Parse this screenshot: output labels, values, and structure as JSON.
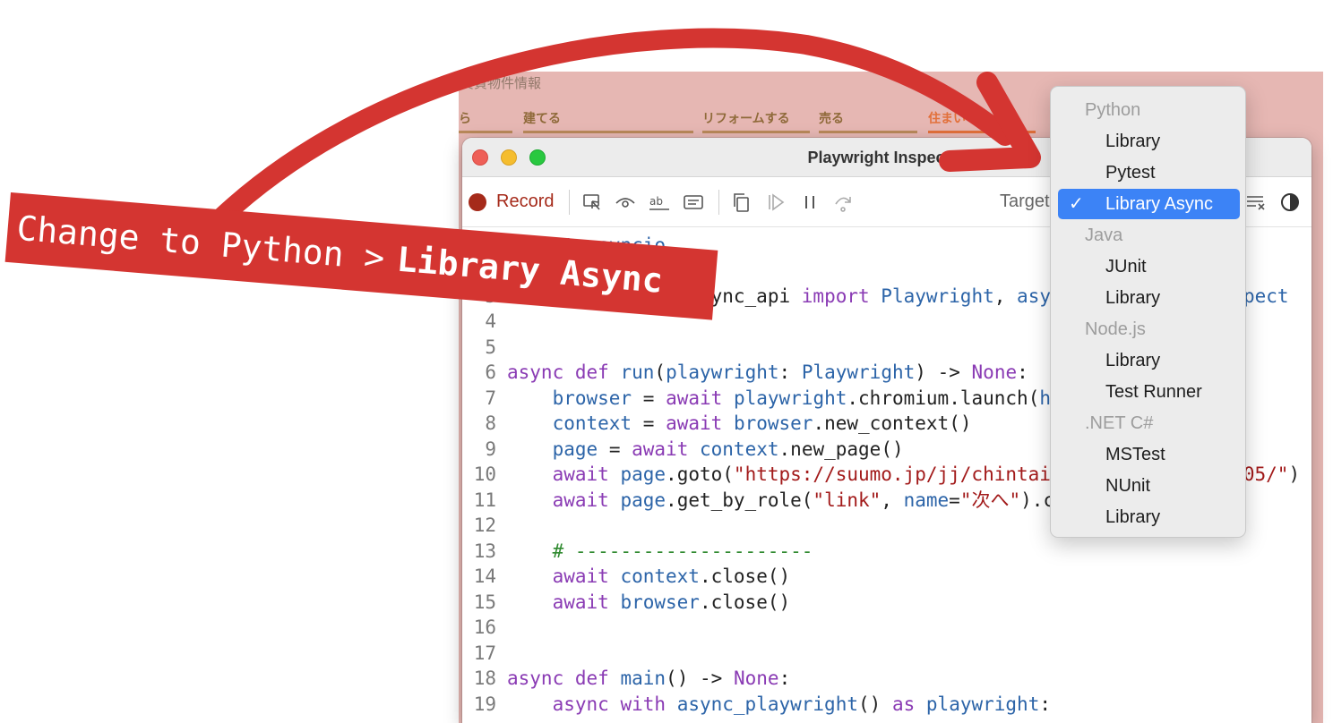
{
  "background_site": {
    "title_fragment": "賃貸物件情報",
    "nav": [
      "ら",
      "建てる",
      "リフォームする",
      "売る",
      "住まい"
    ]
  },
  "window": {
    "title": "Playwright Inspector",
    "record_label": "Record",
    "target_label": "Target:"
  },
  "toolbar_icons": [
    "pick-locator-icon",
    "assert-visibility-icon",
    "assert-text-icon",
    "assert-value-icon",
    "copy-icon",
    "resume-icon",
    "pause-icon",
    "step-over-icon",
    "clear-icon",
    "theme-toggle-icon"
  ],
  "code_lines": [
    {
      "n": "1",
      "text": "import asyncio"
    },
    {
      "n": "3",
      "text": "from playwright.async_api import Playwright, async_playwright, expect"
    },
    {
      "n": "4",
      "text": ""
    },
    {
      "n": "5",
      "text": ""
    },
    {
      "n": "6",
      "text": "async def run(playwright: Playwright) -> None:"
    },
    {
      "n": "7",
      "text": "    browser = await playwright.chromium.launch(headless=False)"
    },
    {
      "n": "8",
      "text": "    context = await browser.new_context()"
    },
    {
      "n": "9",
      "text": "    page = await context.new_page()"
    },
    {
      "n": "10",
      "text": "    await page.goto(\"https://suumo.jp/jj/chintai/ichiran/FR301FC005/\")"
    },
    {
      "n": "11",
      "text": "    await page.get_by_role(\"link\", name=\"次へ\").click()"
    },
    {
      "n": "12",
      "text": ""
    },
    {
      "n": "13",
      "text": "    # ---------------------"
    },
    {
      "n": "14",
      "text": "    await context.close()"
    },
    {
      "n": "15",
      "text": "    await browser.close()"
    },
    {
      "n": "16",
      "text": ""
    },
    {
      "n": "17",
      "text": ""
    },
    {
      "n": "18",
      "text": "async def main() -> None:"
    },
    {
      "n": "19",
      "text": "    async with async_playwright() as playwright:"
    }
  ],
  "menu": {
    "groups": [
      {
        "label": "Python",
        "items": [
          "Library",
          "Pytest",
          "Library Async"
        ]
      },
      {
        "label": "Java",
        "items": [
          "JUnit",
          "Library"
        ]
      },
      {
        "label": "Node.js",
        "items": [
          "Library",
          "Test Runner"
        ]
      },
      {
        "label": ".NET C#",
        "items": [
          "MSTest",
          "NUnit",
          "Library"
        ]
      }
    ],
    "selected": "Library Async",
    "check_glyph": "✓"
  },
  "annotation": {
    "prefix": "Change to Python >",
    "emphasis": "Library Async",
    "color": "#d43531"
  },
  "colors": {
    "record": "#a52a1a",
    "selection": "#3c83f6",
    "keyword": "#8a3bb4",
    "function": "#2c64a8",
    "string": "#a21a1a",
    "comment": "#2f8a2f"
  }
}
